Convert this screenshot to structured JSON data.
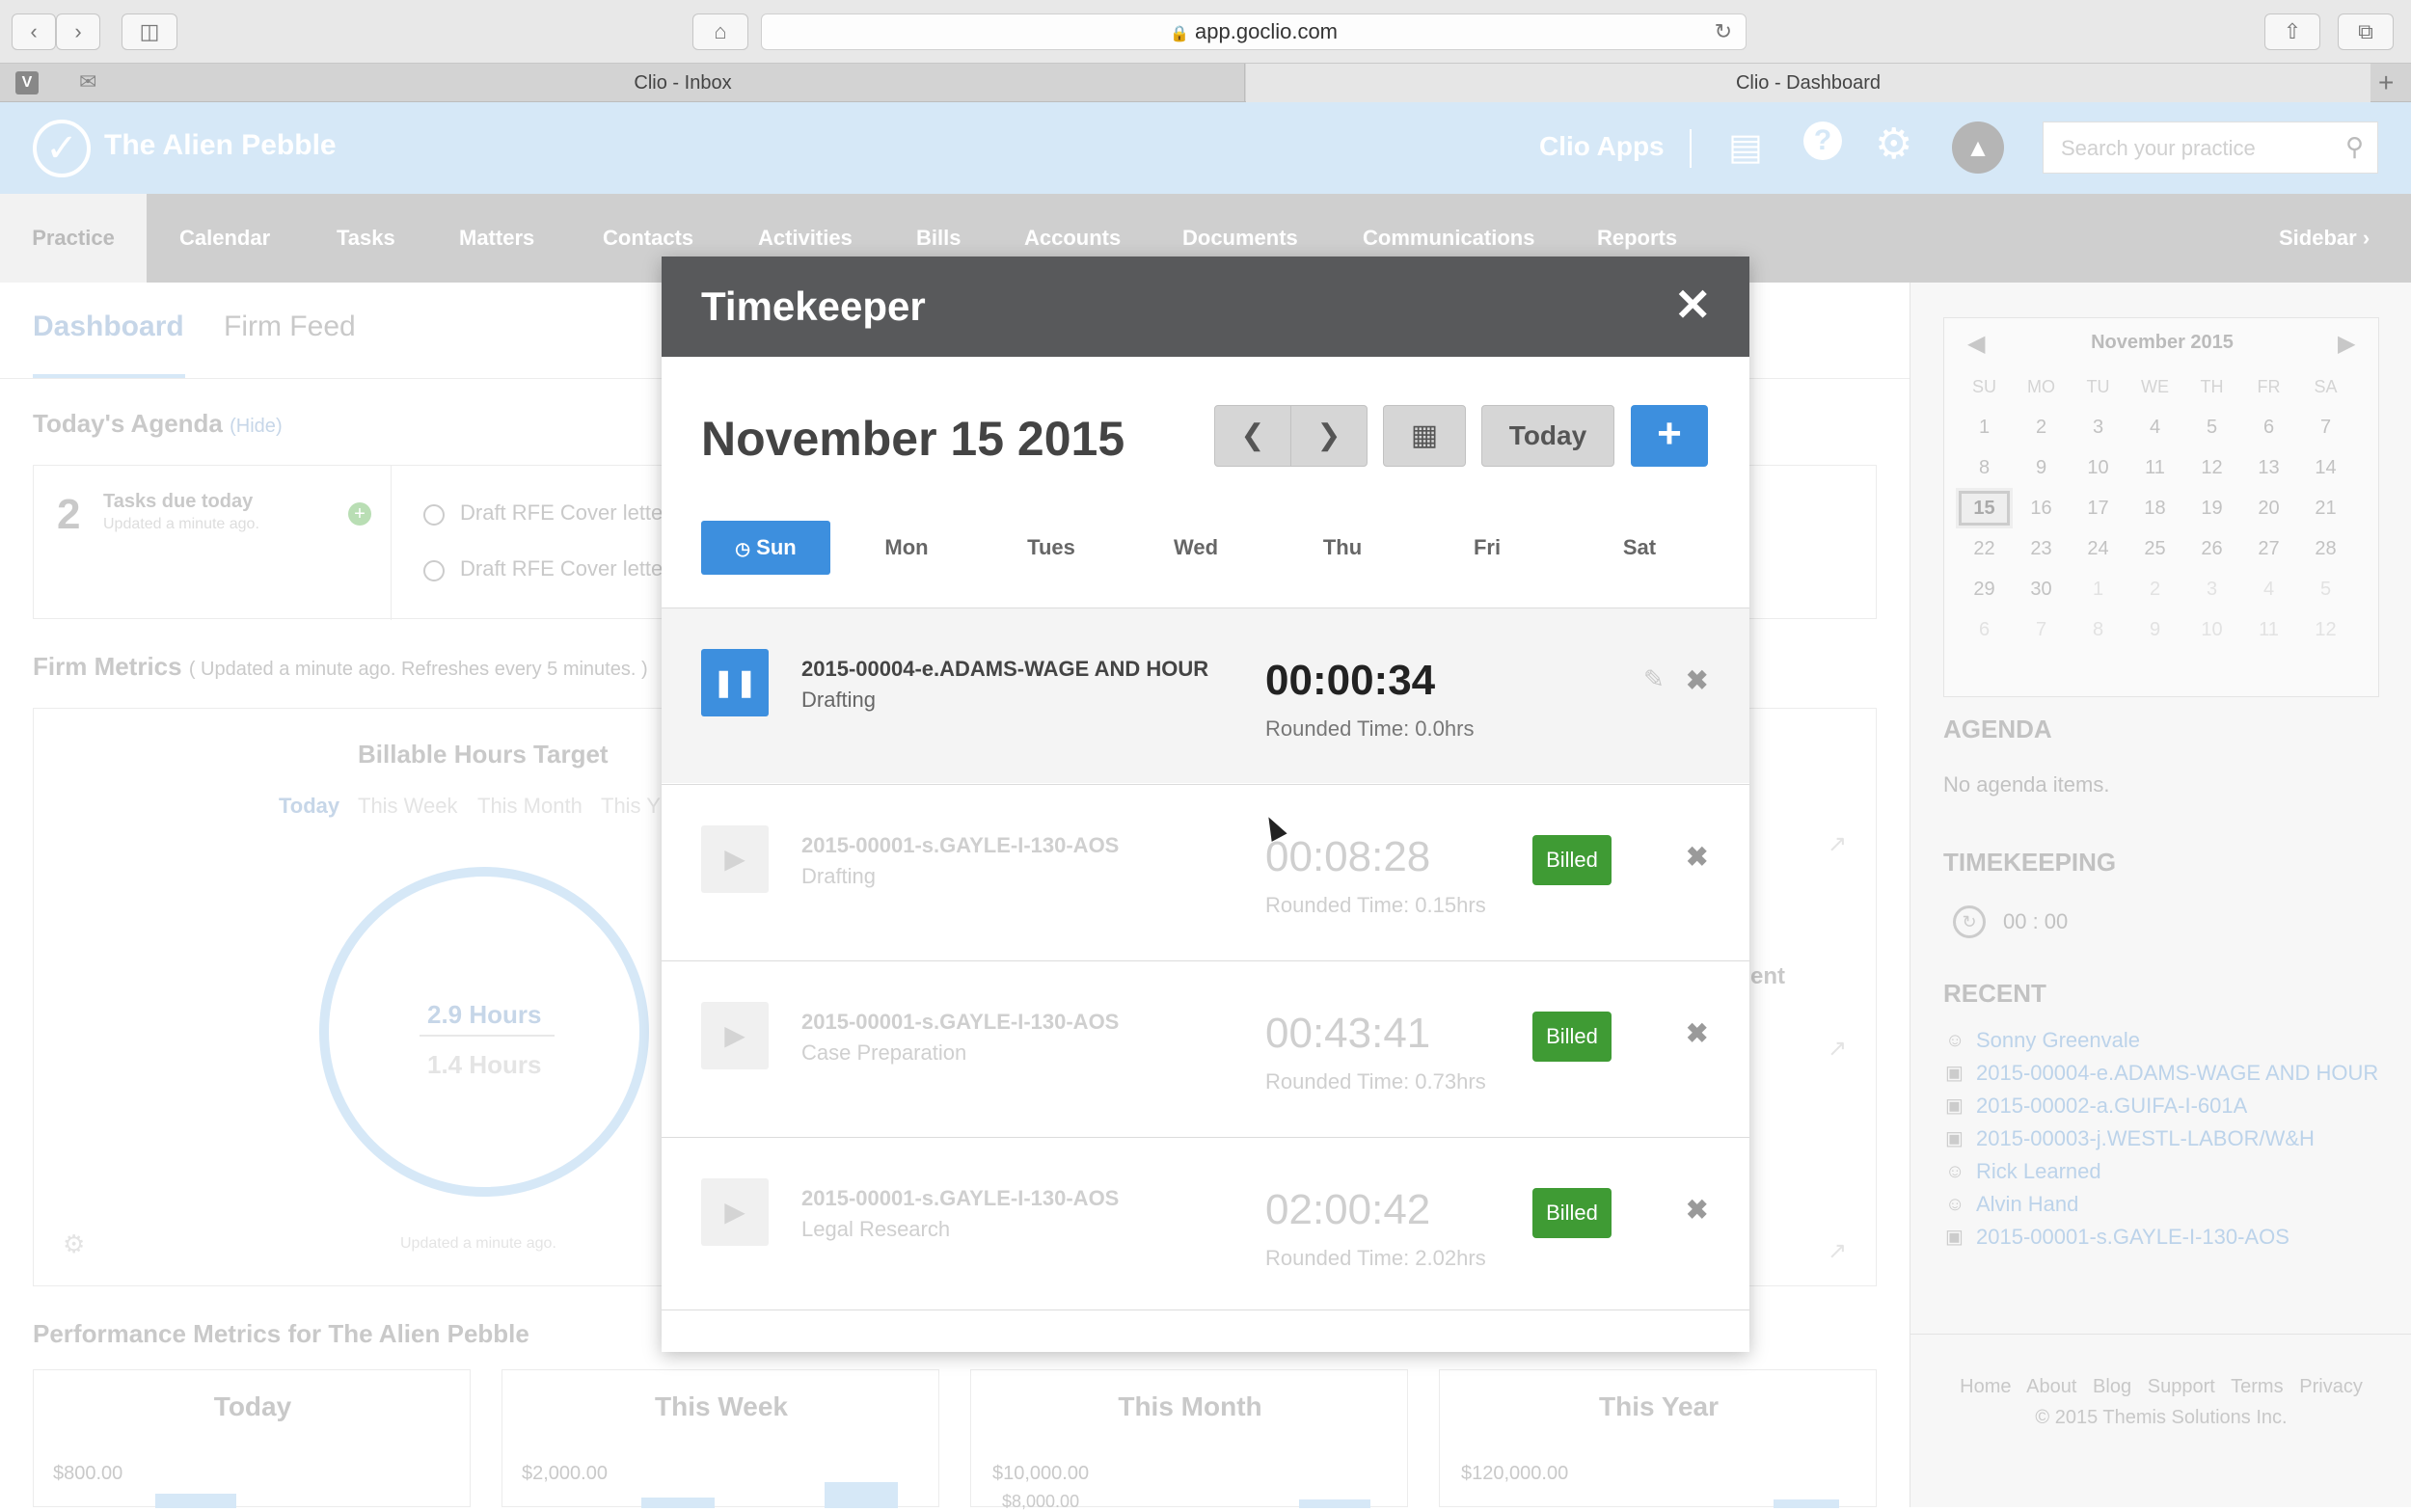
{
  "browser": {
    "url": "app.goclio.com",
    "tabs": [
      "Clio - Inbox",
      "Clio - Dashboard"
    ]
  },
  "header": {
    "brand": "The Alien Pebble",
    "clio_apps": "Clio Apps",
    "search_placeholder": "Search your practice"
  },
  "nav": {
    "items": [
      "Practice",
      "Calendar",
      "Tasks",
      "Matters",
      "Contacts",
      "Activities",
      "Bills",
      "Accounts",
      "Documents",
      "Communications",
      "Reports"
    ],
    "sidebar": "Sidebar"
  },
  "dashboard": {
    "tabs": [
      "Dashboard",
      "Firm Feed"
    ],
    "agenda_title": "Today's Agenda",
    "hide": "Hide",
    "tasks_count": "2",
    "tasks_label": "Tasks due today",
    "tasks_updated": "Updated a minute ago.",
    "task_items": [
      "Draft RFE Cover lette",
      "Draft RFE Cover lette"
    ],
    "firm_metrics": "Firm Metrics",
    "firm_metrics_note": "( Updated a minute ago. Refreshes every 5 minutes. )",
    "billable_title": "Billable Hours Target",
    "periods": [
      "Today",
      "This Week",
      "This Month",
      "This Y"
    ],
    "hours_primary": "2.9 Hours",
    "hours_secondary": "1.4 Hours",
    "updated": "Updated a minute ago.",
    "ent_fragment": "ent",
    "perf_title": "Performance Metrics for The Alien Pebble",
    "perf_cols": [
      {
        "label": "Today",
        "value": "$800.00"
      },
      {
        "label": "This Week",
        "value": "$2,000.00"
      },
      {
        "label": "This Month",
        "value": "$10,000.00",
        "value2": "$8,000.00"
      },
      {
        "label": "This Year",
        "value": "$120,000.00"
      }
    ]
  },
  "sidebar": {
    "month": "November 2015",
    "weekdays": [
      "SU",
      "MO",
      "TU",
      "WE",
      "TH",
      "FR",
      "SA"
    ],
    "weeks": [
      [
        "1",
        "2",
        "3",
        "4",
        "5",
        "6",
        "7"
      ],
      [
        "8",
        "9",
        "10",
        "11",
        "12",
        "13",
        "14"
      ],
      [
        "15",
        "16",
        "17",
        "18",
        "19",
        "20",
        "21"
      ],
      [
        "22",
        "23",
        "24",
        "25",
        "26",
        "27",
        "28"
      ],
      [
        "29",
        "30",
        "1",
        "2",
        "3",
        "4",
        "5"
      ],
      [
        "6",
        "7",
        "8",
        "9",
        "10",
        "11",
        "12"
      ]
    ],
    "agenda_title": "AGENDA",
    "agenda_empty": "No agenda items.",
    "timekeeping_title": "TIMEKEEPING",
    "timer": "00 : 00",
    "recent_title": "RECENT",
    "recent": [
      {
        "icon": "person-icon",
        "label": "Sonny Greenvale"
      },
      {
        "icon": "briefcase-icon",
        "label": "2015-00004-e.ADAMS-WAGE AND HOUR"
      },
      {
        "icon": "briefcase-icon",
        "label": "2015-00002-a.GUIFA-I-601A"
      },
      {
        "icon": "briefcase-icon",
        "label": "2015-00003-j.WESTL-LABOR/W&H"
      },
      {
        "icon": "person-icon",
        "label": "Rick Learned"
      },
      {
        "icon": "person-icon",
        "label": "Alvin Hand"
      },
      {
        "icon": "briefcase-icon",
        "label": "2015-00001-s.GAYLE-I-130-AOS"
      }
    ],
    "footer_links": [
      "Home",
      "About",
      "Blog",
      "Support",
      "Terms",
      "Privacy"
    ],
    "copyright": "© 2015 Themis Solutions Inc."
  },
  "modal": {
    "title": "Timekeeper",
    "date": "November 15 2015",
    "today_label": "Today",
    "days": [
      "Sun",
      "Mon",
      "Tues",
      "Wed",
      "Thu",
      "Fri",
      "Sat"
    ],
    "entries": [
      {
        "matter": "2015-00004-e.ADAMS-WAGE AND HOUR",
        "activity": "Drafting",
        "time": "00:00:34",
        "rounded": "Rounded Time: 0.0hrs",
        "running": true,
        "billed": ""
      },
      {
        "matter": "2015-00001-s.GAYLE-I-130-AOS",
        "activity": "Drafting",
        "time": "00:08:28",
        "rounded": "Rounded Time: 0.15hrs",
        "running": false,
        "billed": "Billed"
      },
      {
        "matter": "2015-00001-s.GAYLE-I-130-AOS",
        "activity": "Case Preparation",
        "time": "00:43:41",
        "rounded": "Rounded Time: 0.73hrs",
        "running": false,
        "billed": "Billed"
      },
      {
        "matter": "2015-00001-s.GAYLE-I-130-AOS",
        "activity": "Legal Research",
        "time": "02:00:42",
        "rounded": "Rounded Time: 2.02hrs",
        "running": false,
        "billed": "Billed"
      }
    ]
  },
  "colors": {
    "accent": "#3d8fde",
    "billed": "#3f9b34",
    "modal_header": "#58595b",
    "app_header": "#d6e8f7"
  }
}
